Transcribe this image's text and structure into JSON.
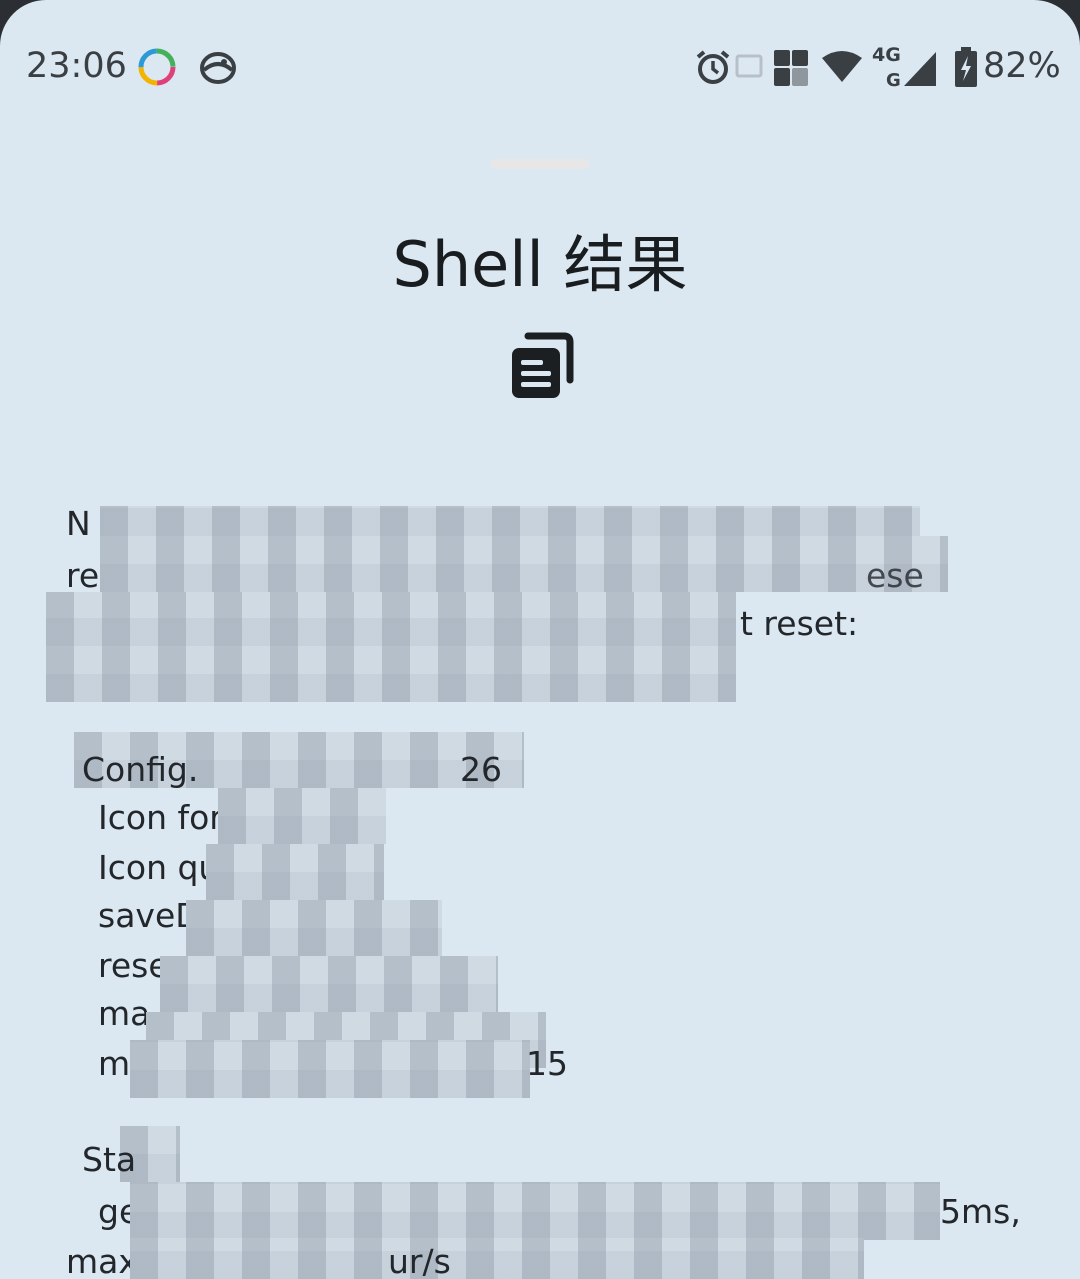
{
  "status_bar": {
    "time": "23:06",
    "network_label": "4G",
    "battery": "82%",
    "icons": [
      "app-ring-icon",
      "face-app-icon",
      "alarm-icon",
      "cast-icon",
      "hd-sim-icon",
      "wifi-icon",
      "signal-icon",
      "battery-charging-icon"
    ]
  },
  "sheet": {
    "title": "Shell 结果",
    "copy_icon": "copy-icon"
  },
  "output": {
    "fragments": {
      "l1_start": "N",
      "l2_start": "re",
      "l2_end": "ese",
      "l3_end": "t reset:",
      "l5_start": "Config.",
      "l5_mid": "26",
      "l6_start": "Icon for",
      "l7_start": "Icon qu",
      "l8_start": "saveD",
      "l9_start": "rese",
      "l10_start": "ma",
      "l11_start": "m",
      "l11_end": "15",
      "l13_start": "Sta",
      "l14_start": "ge",
      "l14_end": "5ms,",
      "l15_start": "max",
      "l15_mid": "ur/s"
    }
  }
}
